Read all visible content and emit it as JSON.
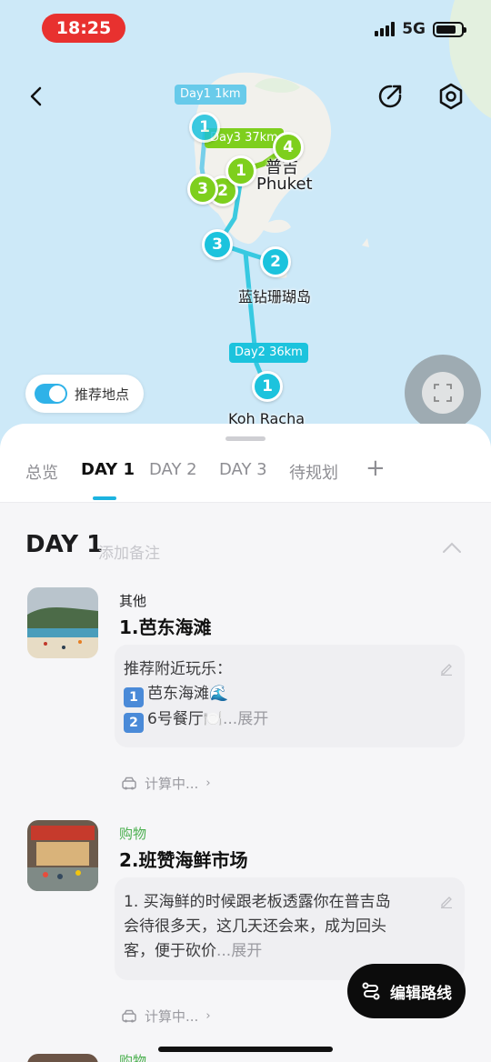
{
  "status_bar": {
    "time": "18:25",
    "network": "5G"
  },
  "map": {
    "route_labels": [
      {
        "text": "Day1 1km",
        "color": "#62c9ea"
      },
      {
        "text": "Day3 37km",
        "color": "#7ecf1d"
      },
      {
        "text": "Day2 36km",
        "color": "#1cc3dd"
      }
    ],
    "pins": [
      {
        "label": "1",
        "color": "blue"
      },
      {
        "label": "4",
        "color": "green"
      },
      {
        "label": "1",
        "color": "green"
      },
      {
        "label": "2",
        "color": "green"
      },
      {
        "label": "3",
        "color": "green"
      },
      {
        "label": "3",
        "color": "blue"
      },
      {
        "label": "2",
        "color": "blue"
      },
      {
        "label": "1",
        "color": "blue"
      }
    ],
    "place_labels": [
      "普吉",
      "Phuket",
      "蓝钻珊瑚岛",
      "Koh Racha"
    ],
    "recommend_toggle": {
      "label": "推荐地点",
      "on": true
    }
  },
  "tabs": [
    "总览",
    "DAY 1",
    "DAY 2",
    "DAY 3",
    "待规划",
    "+"
  ],
  "active_tab": "DAY 1",
  "day": {
    "title": "DAY 1",
    "note_placeholder": "添加备注"
  },
  "items": [
    {
      "category": "其他",
      "category_color": "#3a3a3c",
      "title": "1.芭东海滩",
      "note_lines": [
        "推荐附近玩乐：",
        "芭东海滩🌊",
        "6号餐厅🍽️"
      ],
      "note_more": "...展开",
      "travel": "计算中..."
    },
    {
      "category": "购物",
      "category_color": "#4cb050",
      "title": "2.班赞海鲜市场",
      "note_text_1": "1. 买海鲜的时候跟老板透露你在普吉岛",
      "note_text_2": "会待很多天，这几天还会来，成为回头",
      "note_text_3": "客，便于砍价",
      "note_more": "...展开",
      "travel": "计算中..."
    },
    {
      "category": "购物"
    }
  ],
  "edit_route_button": "编辑路线",
  "colors": {
    "accent": "#1cb3e0",
    "day1_route": "#62c9ea",
    "day2_route": "#1cc3dd",
    "day3_route": "#7ecf1d"
  }
}
